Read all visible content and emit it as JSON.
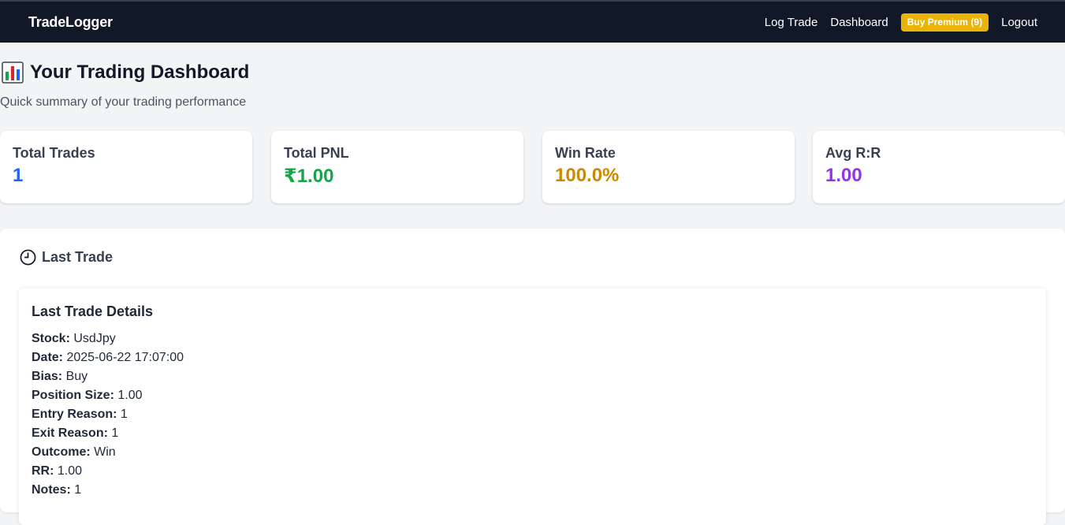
{
  "navbar": {
    "brand": "TradeLogger",
    "links": {
      "log_trade": "Log Trade",
      "dashboard": "Dashboard",
      "buy_premium": "Buy Premium (9)",
      "logout": "Logout"
    },
    "premium_color": "#eab308"
  },
  "header": {
    "icon": "bar-chart-icon",
    "title": "Your Trading Dashboard",
    "subtitle": "Quick summary of your trading performance"
  },
  "stats": [
    {
      "label": "Total Trades",
      "value": "1",
      "color": "#2563eb"
    },
    {
      "label": "Total PNL",
      "value": "₹1.00",
      "color": "#16a34a"
    },
    {
      "label": "Win Rate",
      "value": "100.0%",
      "color": "#ca8a04"
    },
    {
      "label": "Avg R:R",
      "value": "1.00",
      "color": "#9333ea"
    }
  ],
  "last_trade": {
    "icon": "clock-icon",
    "heading": "Last Trade",
    "details_title": "Last Trade Details",
    "fields": [
      {
        "key": "Stock:",
        "value": "UsdJpy"
      },
      {
        "key": "Date:",
        "value": "2025-06-22 17:07:00"
      },
      {
        "key": "Bias:",
        "value": "Buy"
      },
      {
        "key": "Position Size:",
        "value": "1.00"
      },
      {
        "key": "Entry Reason:",
        "value": "1"
      },
      {
        "key": "Exit Reason:",
        "value": "1"
      },
      {
        "key": "Outcome:",
        "value": "Win"
      },
      {
        "key": "RR:",
        "value": "1.00"
      },
      {
        "key": "Notes:",
        "value": "1"
      }
    ]
  }
}
